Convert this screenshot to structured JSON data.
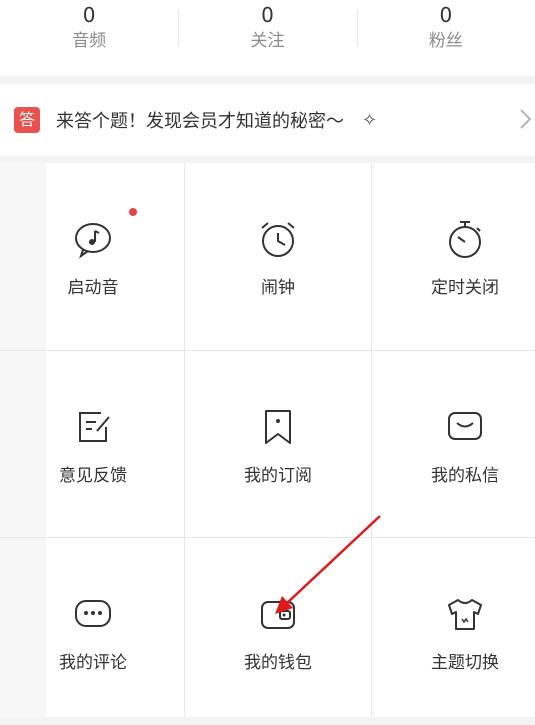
{
  "stats": [
    {
      "value": "0",
      "label": "音频"
    },
    {
      "value": "0",
      "label": "关注"
    },
    {
      "value": "0",
      "label": "粉丝"
    }
  ],
  "banner": {
    "badge": "答",
    "text": "来答个题！发现会员才知道的秘密～",
    "sparkle": "✧"
  },
  "grid": [
    {
      "label": "启动音",
      "icon": "music-bubble-icon",
      "dot": true
    },
    {
      "label": "闹钟",
      "icon": "alarm-clock-icon"
    },
    {
      "label": "定时关闭",
      "icon": "stopwatch-icon"
    },
    {
      "label": "意见反馈",
      "icon": "feedback-edit-icon"
    },
    {
      "label": "我的订阅",
      "icon": "bookmark-icon"
    },
    {
      "label": "我的私信",
      "icon": "message-icon"
    },
    {
      "label": "我的评论",
      "icon": "comment-icon"
    },
    {
      "label": "我的钱包",
      "icon": "wallet-icon"
    },
    {
      "label": "主题切换",
      "icon": "tshirt-icon"
    }
  ],
  "colors": {
    "accent": "#e9414a",
    "badge": "#e9524d",
    "arrow": "#e0191b"
  }
}
